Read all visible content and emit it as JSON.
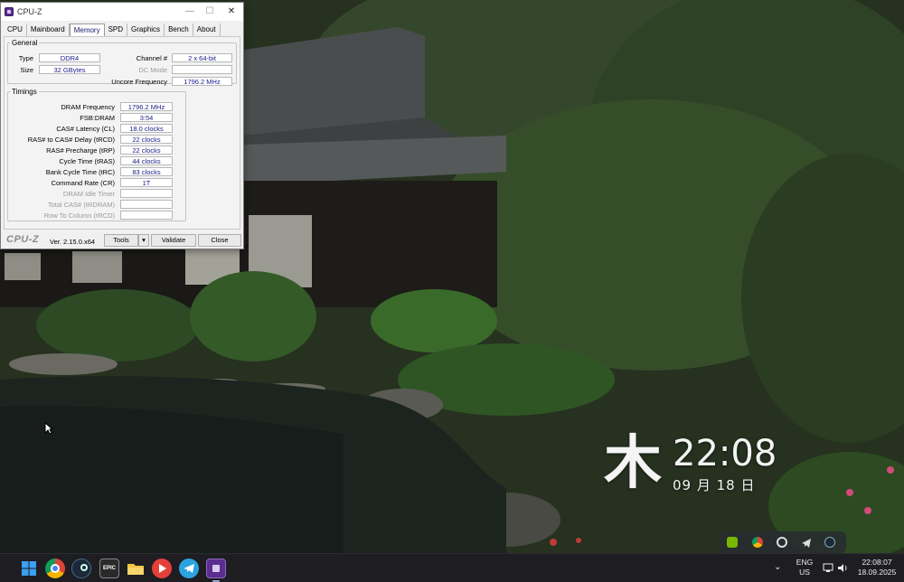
{
  "window": {
    "title": "CPU-Z",
    "tabs": [
      "CPU",
      "Mainboard",
      "Memory",
      "SPD",
      "Graphics",
      "Bench",
      "About"
    ],
    "active_tab": "Memory"
  },
  "general": {
    "legend": "General",
    "type_label": "Type",
    "type_value": "DDR4",
    "size_label": "Size",
    "size_value": "32 GBytes",
    "channel_label": "Channel #",
    "channel_value": "2 x 64-bit",
    "dcmode_label": "DC Mode",
    "dcmode_value": "",
    "uncore_label": "Uncore Frequency",
    "uncore_value": "1796.2 MHz"
  },
  "timings": {
    "legend": "Timings",
    "rows": [
      {
        "label": "DRAM Frequency",
        "value": "1796.2 MHz",
        "enabled": true
      },
      {
        "label": "FSB:DRAM",
        "value": "3:54",
        "enabled": true
      },
      {
        "label": "CAS# Latency (CL)",
        "value": "18.0 clocks",
        "enabled": true
      },
      {
        "label": "RAS# to CAS# Delay (tRCD)",
        "value": "22 clocks",
        "enabled": true
      },
      {
        "label": "RAS# Precharge (tRP)",
        "value": "22 clocks",
        "enabled": true
      },
      {
        "label": "Cycle Time (tRAS)",
        "value": "44 clocks",
        "enabled": true
      },
      {
        "label": "Bank Cycle Time (tRC)",
        "value": "83 clocks",
        "enabled": true
      },
      {
        "label": "Command Rate (CR)",
        "value": "1T",
        "enabled": true
      },
      {
        "label": "DRAM Idle Timer",
        "value": "",
        "enabled": false
      },
      {
        "label": "Total CAS# (tRDRAM)",
        "value": "",
        "enabled": false
      },
      {
        "label": "Row To Column (tRCD)",
        "value": "",
        "enabled": false
      }
    ]
  },
  "footer": {
    "brand": "CPU-Z",
    "version": "Ver. 2.15.0.x64",
    "tools_label": "Tools",
    "validate_label": "Validate",
    "close_label": "Close"
  },
  "desktop_clock": {
    "weekday_kanji": "木",
    "time": "22:08",
    "date": "09 月 18 日"
  },
  "taskbar": {
    "apps": [
      "windows-start",
      "chrome",
      "steam",
      "epic-games",
      "file-explorer",
      "media-player",
      "telegram",
      "cpu-z"
    ],
    "epic_label": "EPIC",
    "language_line1": "ENG",
    "language_line2": "US",
    "clock_time": "22:08:07",
    "clock_date": "18.09.2025",
    "tray_icons": [
      "nvidia",
      "chrome",
      "sync",
      "telegram",
      "steam"
    ]
  },
  "colors": {
    "taskbar_bg": "#1d1d22",
    "value_text": "#1a1a8a",
    "window_bg": "#f0f0f0"
  }
}
